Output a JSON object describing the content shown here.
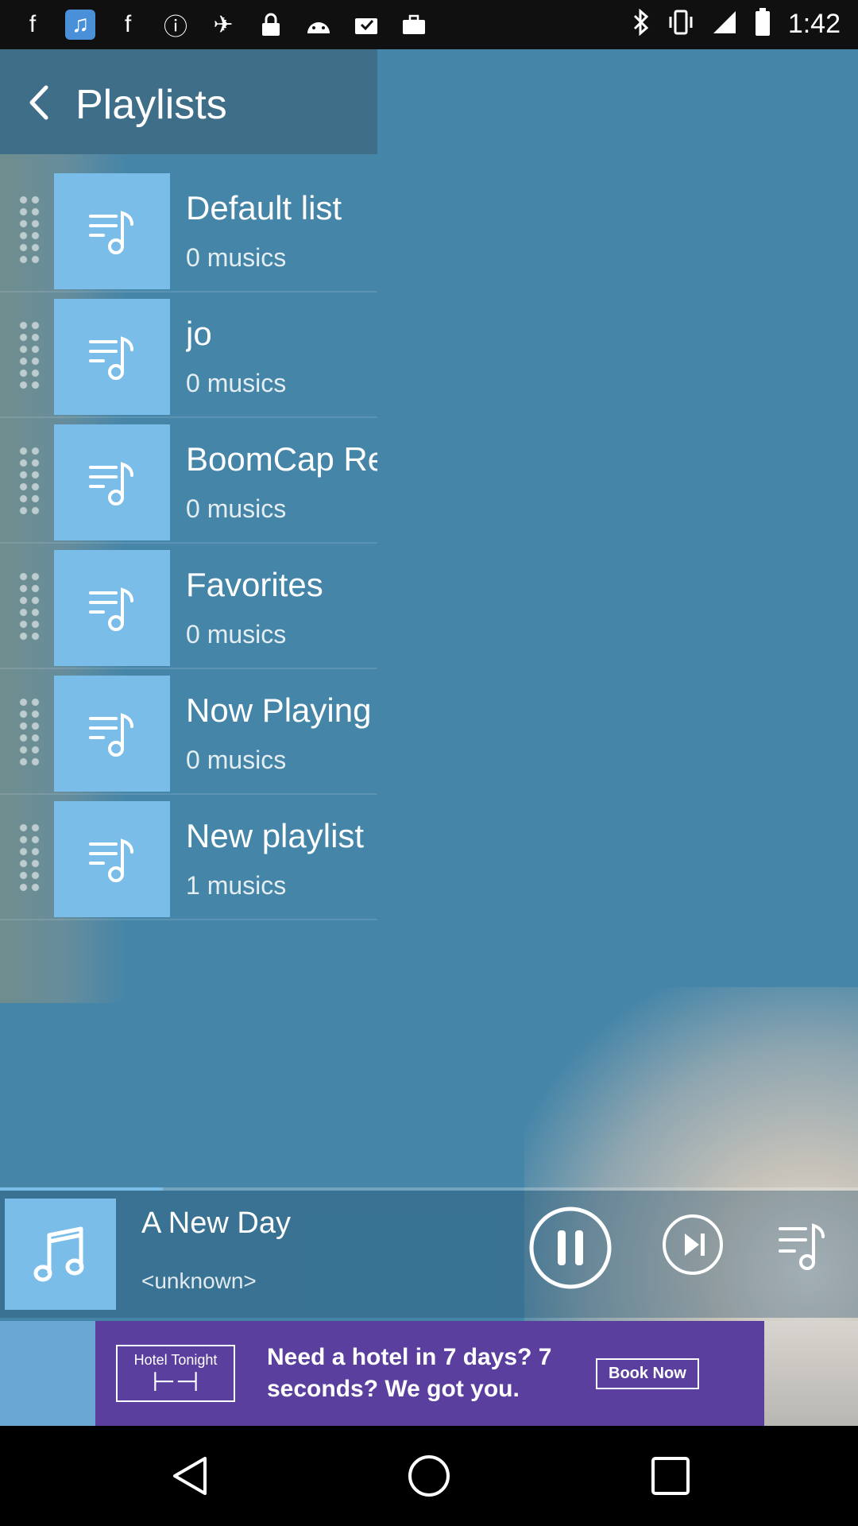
{
  "status_bar": {
    "time": "1:42",
    "left_icons": [
      "facebook-icon",
      "music-icon",
      "facebook-icon",
      "info-icon",
      "fake-gps-icon",
      "lock-icon",
      "android-icon",
      "inbox-icon",
      "briefcase-icon"
    ],
    "right_icons": [
      "bluetooth-icon",
      "vibrate-icon",
      "signal-icon",
      "battery-icon"
    ]
  },
  "header": {
    "title": "Playlists"
  },
  "playlists": [
    {
      "name": "Default list",
      "count": "0 musics"
    },
    {
      "name": "jo",
      "count": "0 musics"
    },
    {
      "name": "BoomCap Re",
      "count": "0 musics"
    },
    {
      "name": "Favorites",
      "count": "0 musics"
    },
    {
      "name": "Now Playing",
      "count": "0 musics"
    },
    {
      "name": "New playlist",
      "count": "1 musics"
    }
  ],
  "player": {
    "song": "A New Day",
    "artist": "<unknown>",
    "progress": 0.19
  },
  "ad": {
    "brand": "Hotel Tonight",
    "headline": "Need a hotel in 7 days? 7 seconds? We got you.",
    "cta": "Book Now"
  },
  "colors": {
    "background": "#4585a8",
    "header": "#3f6e88",
    "thumb": "#7bbde9",
    "ad": "#5a3f9e"
  }
}
